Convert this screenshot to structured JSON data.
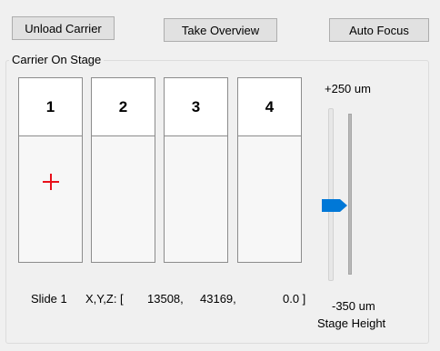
{
  "toolbar": {
    "unload_label": "Unload Carrier",
    "overview_label": "Take Overview",
    "autofocus_label": "Auto Focus"
  },
  "carrier": {
    "title": "Carrier On Stage",
    "slots": [
      {
        "label": "1",
        "has_marker": true
      },
      {
        "label": "2",
        "has_marker": false
      },
      {
        "label": "3",
        "has_marker": false
      },
      {
        "label": "4",
        "has_marker": false
      }
    ],
    "marker_color": "#e8101a"
  },
  "stage_height": {
    "max_label": "+250 um",
    "min_label": "-350 um",
    "caption": "Stage Height",
    "max_um": 250,
    "min_um": -350,
    "current_level": 0.43,
    "thumb_color": "#0078d7"
  },
  "status": {
    "slide": "Slide 1",
    "coord_label": "X,Y,Z: [",
    "x": "13508,",
    "y": "43169,",
    "z": "0.0 ]"
  }
}
